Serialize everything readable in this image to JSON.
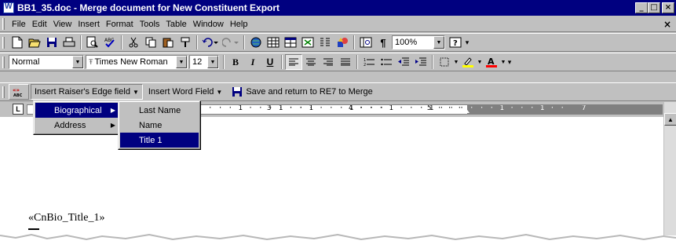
{
  "window": {
    "title": "BB1_35.doc - Merge document for New Constituent Export",
    "buttons": {
      "minimize": "_",
      "restore": "□",
      "close": "×"
    }
  },
  "menubar": {
    "items": [
      "File",
      "Edit",
      "View",
      "Insert",
      "Format",
      "Tools",
      "Table",
      "Window",
      "Help"
    ],
    "doc_close": "×"
  },
  "standard_toolbar": {
    "icons": [
      "new-icon",
      "open-icon",
      "save-icon",
      "print-icon",
      "print-preview-icon",
      "spelling-icon",
      "cut-icon",
      "copy-icon",
      "paste-icon",
      "format-painter-icon",
      "undo-icon",
      "redo-icon",
      "hyperlink-icon",
      "tables-icon",
      "insert-table-icon",
      "excel-icon",
      "columns-icon",
      "drawing-icon",
      "document-map-icon",
      "show-hide-icon"
    ],
    "zoom": "100%",
    "help_icon": "help-icon"
  },
  "formatting_toolbar": {
    "style": "Normal",
    "font": "Times New Roman",
    "size": "12",
    "bold": "B",
    "italic": "I",
    "underline": "U"
  },
  "merge_toolbar": {
    "field_button": "Insert Raiser's Edge field",
    "word_field_button": "Insert Word Field",
    "save_button": "Save and return to RE7 to Merge"
  },
  "menus": {
    "level1": [
      "Biographical",
      "Address"
    ],
    "level2": [
      "Last Name",
      "Name",
      "Title 1"
    ],
    "selected_level1": "Biographical",
    "selected_level2": "Title 1"
  },
  "ruler": {
    "numbers": [
      "3",
      "4",
      "5",
      "7"
    ]
  },
  "document": {
    "field_code": "«CnBio_Title_1»"
  }
}
